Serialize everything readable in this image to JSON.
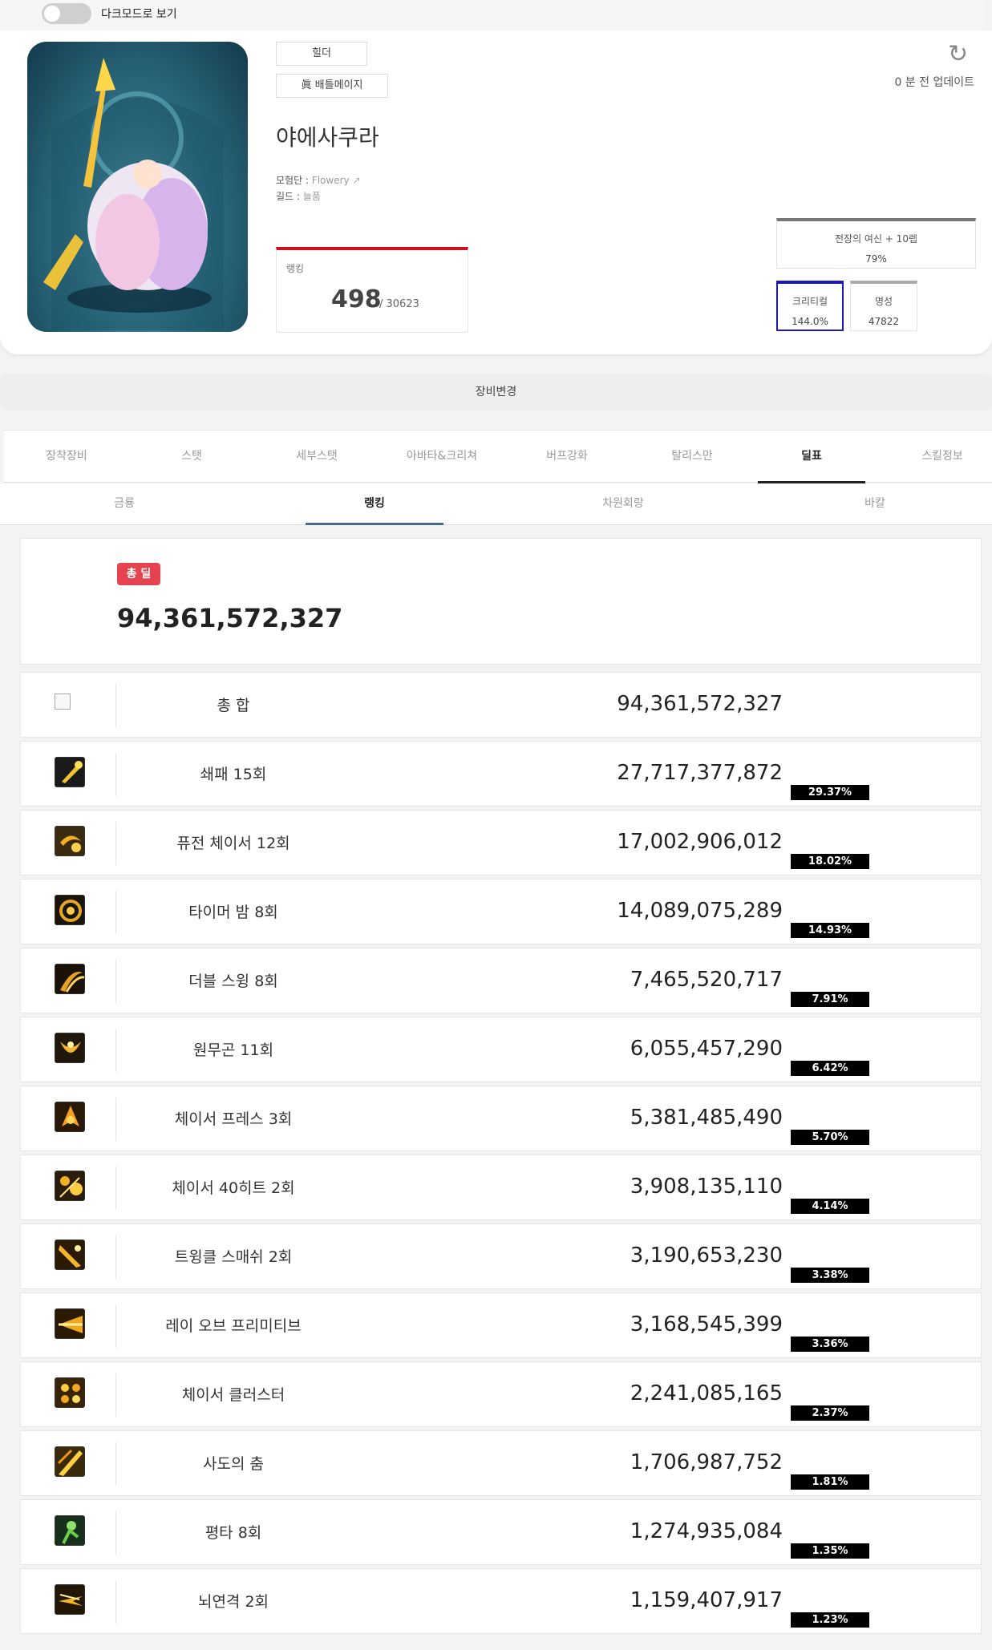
{
  "topbar": {
    "darkmode_label": "다크모드로 보기"
  },
  "profile": {
    "job": "힐더",
    "server": "眞 배틀메이지",
    "name": "야에사쿠라",
    "adventure_label": "모험단 : ",
    "adventure_value": "Flowery",
    "guild_label": "길드 : ",
    "guild_value": "늘품",
    "updated": "0 분 전 업데이트",
    "rank_label": "랭킹",
    "rank_value": "498",
    "rank_total": "/ 30623",
    "buff_title": "전장의 여신 + 10렙",
    "buff_value": "79%",
    "crit_label": "크리티컬",
    "crit_value": "144.0%",
    "fame_label": "명성",
    "fame_value": "47822"
  },
  "equip_change": "장비변경",
  "tabs": [
    "장착장비",
    "스탯",
    "세부스탯",
    "아바타&크리쳐",
    "버프강화",
    "탈리스만",
    "딜표",
    "스킬정보"
  ],
  "active_tab": 6,
  "subtabs": [
    "금룡",
    "랭킹",
    "차원회랑",
    "바칼"
  ],
  "active_subtab": 1,
  "summary": {
    "badge": "총 딜",
    "total": "94,361,572,327"
  },
  "rows": [
    {
      "name": "총 합",
      "value": "94,361,572,327",
      "pct": "",
      "icon": "total-image"
    },
    {
      "name": "쇄패 15회",
      "value": "27,717,377,872",
      "pct": "29.37%",
      "icon": "shatter-icon"
    },
    {
      "name": "퓨전 체이서 12회",
      "value": "17,002,906,012",
      "pct": "18.02%",
      "icon": "fusion-chaser-icon"
    },
    {
      "name": "타이머 밤 8회",
      "value": "14,089,075,289",
      "pct": "14.93%",
      "icon": "timer-bomb-icon"
    },
    {
      "name": "더블 스윙 8회",
      "value": "7,465,520,717",
      "pct": "7.91%",
      "icon": "double-swing-icon"
    },
    {
      "name": "원무곤 11회",
      "value": "6,055,457,290",
      "pct": "6.42%",
      "icon": "dance-staff-icon"
    },
    {
      "name": "체이서 프레스 3회",
      "value": "5,381,485,490",
      "pct": "5.70%",
      "icon": "chaser-press-icon"
    },
    {
      "name": "체이서 40히트 2회",
      "value": "3,908,135,110",
      "pct": "4.14%",
      "icon": "chaser-hit-icon"
    },
    {
      "name": "트윙클 스매쉬 2회",
      "value": "3,190,653,230",
      "pct": "3.38%",
      "icon": "twinkle-smash-icon"
    },
    {
      "name": "레이 오브 프리미티브",
      "value": "3,168,545,399",
      "pct": "3.36%",
      "icon": "ray-of-primitive-icon"
    },
    {
      "name": "체이서 클러스터",
      "value": "2,241,085,165",
      "pct": "2.37%",
      "icon": "chaser-cluster-icon"
    },
    {
      "name": "사도의 춤",
      "value": "1,706,987,752",
      "pct": "1.81%",
      "icon": "apostle-dance-icon"
    },
    {
      "name": "평타 8회",
      "value": "1,274,935,084",
      "pct": "1.35%",
      "icon": "basic-attack-icon"
    },
    {
      "name": "뇌연격 2회",
      "value": "1,159,407,917",
      "pct": "1.23%",
      "icon": "thunder-strike-icon"
    }
  ]
}
